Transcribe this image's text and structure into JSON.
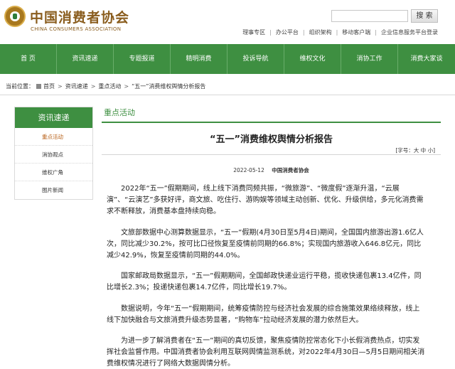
{
  "header": {
    "brand_cn": "中国消费者协会",
    "brand_en": "CHINA CONSUMERS ASSOCIATION",
    "search_placeholder": "",
    "search_button": "搜 索",
    "top_links": [
      "理事专区",
      "办公平台",
      "组织架构",
      "移动客户端",
      "企业信息服务平台登录"
    ]
  },
  "nav": {
    "items": [
      "首 页",
      "资讯速递",
      "专题报道",
      "精明消费",
      "投诉导航",
      "维权文化",
      "消协工作",
      "消费大家谈"
    ]
  },
  "breadcrumb": {
    "prefix": "当前位置：",
    "items": [
      "首页",
      "资讯速递",
      "重点活动",
      "“五一”消费维权舆情分析报告"
    ]
  },
  "sidebar": {
    "heading": "资讯速递",
    "items": [
      "重点活动",
      "消协观点",
      "维权广角",
      "图片新闻"
    ],
    "active_index": 0
  },
  "main": {
    "section_label": "重点活动",
    "title": "“五一”消费维权舆情分析报告",
    "font_size_label": "[字号：大 中 小]",
    "date": "2022-05-12",
    "org": "中国消费者协会",
    "paragraphs": [
      "2022年“五一”假期期间，线上线下消费同频共振，“微旅游”、“微度假”逐渐升温，“云展演”、“云演艺”多获好评，商文旅、吃住行、游购娱等领域主动创新、优化、升级供给，多元化消费需求不断释放，消费基本盘持续向稳。",
      "文旅部数据中心测算数据显示，“五一”假期(4月30日至5月4日)期间，全国国内旅游出游1.6亿人次，同比减少30.2%，按可比口径恢复至疫情前同期的66.8%；实现国内旅游收入646.8亿元，同比减少42.9%，恢复至疫情前同期的44.0%。",
      "国家邮政局数据显示，“五一”假期期间，全国邮政快递业运行平稳，揽收快递包裹13.4亿件，同比增长2.3%；投递快递包裹14.7亿件，同比增长19.7%。",
      "数据说明，今年“五一”假期期间，统筹疫情防控与经济社会发展的综合施策效果络续释放，线上线下加快融合与文旅消费升级态势显著，“购物车”拉动经济发展的潜力依然巨大。",
      "为进一步了解消费者在“五一”期间的真切反馈，聚焦疫情防控常态化下小长假消费热点，切实发挥社会监督作用。中国消费者协会利用互联网舆情监测系统，对2022年4月30日—5月5日期间相关消费维权情况进行了网络大数据舆情分析。"
    ]
  }
}
